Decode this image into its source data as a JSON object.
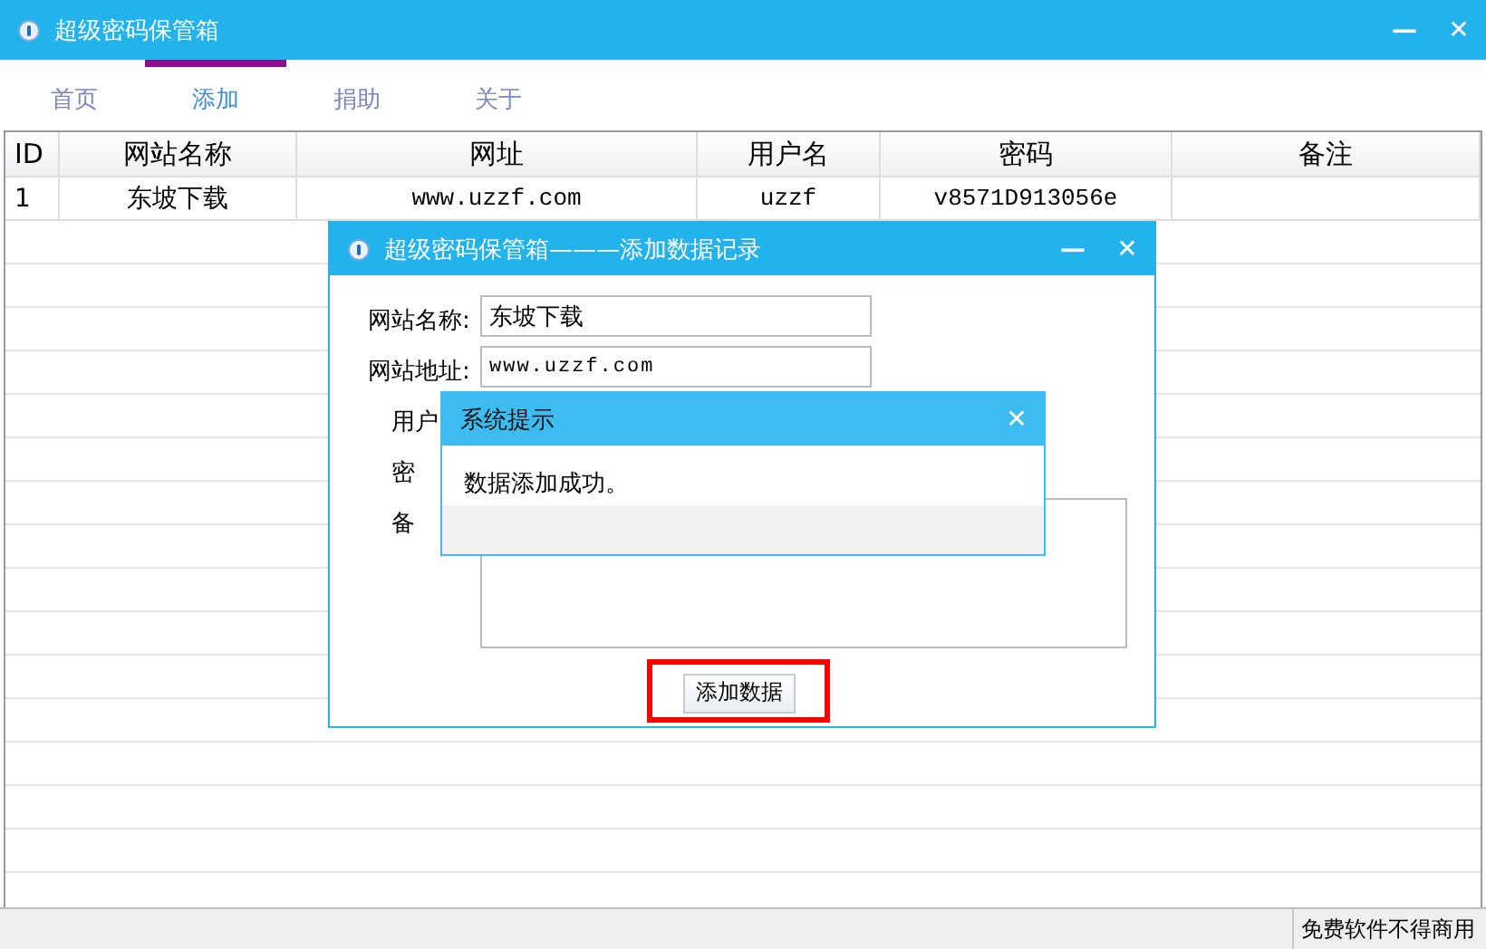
{
  "window": {
    "title": "超级密码保管箱",
    "buttons": [
      "—",
      "✕"
    ]
  },
  "tabs": [
    {
      "label": "首页",
      "selected": false
    },
    {
      "label": "添加",
      "selected": true
    },
    {
      "label": "捐助",
      "selected": false
    },
    {
      "label": "关于",
      "selected": false
    }
  ],
  "table": {
    "columns": [
      "ID",
      "网站名称",
      "网址",
      "用户名",
      "密码",
      "备注"
    ],
    "rows": [
      [
        "1",
        "东坡下载",
        "www.uzzf.com",
        "uzzf",
        "v8571D913056e",
        ""
      ]
    ]
  },
  "dialog": {
    "title": "超级密码保管箱———添加数据记录",
    "buttons": [
      "—",
      "✕"
    ],
    "fields": [
      {
        "label": "网站名称:",
        "value": "东坡下载",
        "kind": "text"
      },
      {
        "label": "网站地址:",
        "value": "www.uzzf.com",
        "kind": "mono"
      },
      {
        "label": "用户",
        "kind": "covered"
      },
      {
        "label": "密",
        "kind": "covered"
      },
      {
        "label": "备",
        "kind": "area"
      }
    ],
    "submit": "添加数据",
    "highlighted": true
  },
  "message_box": {
    "title": "系统提示",
    "buttons": [
      "✕"
    ],
    "text": "数据添加成功。"
  },
  "status_bar": {
    "text": "免费软件不得商用"
  }
}
